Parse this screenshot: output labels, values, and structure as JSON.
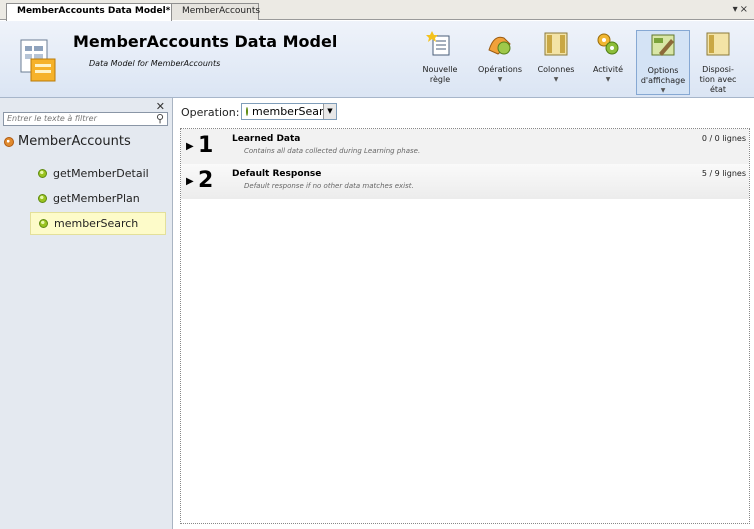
{
  "tabs": [
    {
      "label": "MemberAccounts Data Model*"
    },
    {
      "label": "MemberAccounts"
    }
  ],
  "header": {
    "title": "MemberAccounts Data Model",
    "subtitle": "Data Model for MemberAccounts"
  },
  "toolbar": {
    "new_rule": {
      "line1": "Nouvelle",
      "line2": "règle"
    },
    "operations": {
      "label": "Opérations"
    },
    "columns": {
      "label": "Colonnes"
    },
    "activity": {
      "label": "Activité"
    },
    "display_options": {
      "line1": "Options",
      "line2": "d'affichage"
    },
    "layout": {
      "line1": "Disposi-",
      "line2": "tion avec",
      "line3": "état"
    }
  },
  "sidebar": {
    "filter_placeholder": "Entrer le texte à filtrer",
    "root": "MemberAccounts",
    "items": [
      {
        "label": "getMemberDetail"
      },
      {
        "label": "getMemberPlan"
      },
      {
        "label": "memberSearch"
      }
    ]
  },
  "main": {
    "operation_label": "Operation:",
    "operation_value": "memberSearch",
    "rules": [
      {
        "number": "1",
        "title": "Learned Data",
        "description": "Contains all data collected during Learning phase.",
        "count": "0 / 0 lignes"
      },
      {
        "number": "2",
        "title": "Default Response",
        "description": "Default response if no other data matches exist.",
        "count": "5 / 9 lignes"
      }
    ]
  }
}
